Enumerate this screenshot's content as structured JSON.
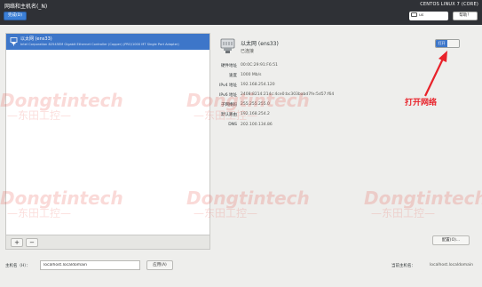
{
  "header": {
    "title": "网络和主机名(_N)",
    "done_label": "完成(D)",
    "os_label": "CENTOS LINUX 7 (CORE)",
    "keyboard_label": "us",
    "help_label": "帮助！"
  },
  "connection_list": {
    "items": [
      {
        "name": "以太网 (ens33)",
        "description": "Intel Corporation 82545EM Gigabit Ethernet Controller (Copper) (PRO/1000 MT Single Port Adapter)",
        "selected": true
      }
    ],
    "add_label": "+",
    "remove_label": "−"
  },
  "details": {
    "name": "以太网 (ens33)",
    "status": "已连接",
    "toggle_label": "打开",
    "toggle_state": "on",
    "info": [
      {
        "label": "硬件地址",
        "value": "00:0C:29:91:F6:51"
      },
      {
        "label": "速度",
        "value": "1000 Mb/s"
      },
      {
        "label": "IPv4 地址",
        "value": "192.168.254.120"
      },
      {
        "label": "IPv6 地址",
        "value": "2408:8214:214c:4ce0:bc303babd7fe:5d57:f64"
      },
      {
        "label": "子网掩码",
        "value": "255.255.255.0"
      },
      {
        "label": "默认路由",
        "value": "192.168.254.2"
      },
      {
        "label": "DNS",
        "value": "202.100.134.86"
      }
    ],
    "configure_label": "配置(O)..."
  },
  "annotation": {
    "text": "打开网络",
    "color": "#e8222a"
  },
  "footer": {
    "hostname_label": "主机名（H）：",
    "hostname_value": "localhost.localdomain",
    "apply_label": "应用(A)",
    "current_hostname_label": "当前主机名：",
    "current_hostname_value": "localhost.localdomain"
  },
  "watermark": {
    "brand": "Dongtintech",
    "brand_cn": "—东田工控—",
    "color": "#e8463c"
  },
  "colors": {
    "topbar": "#2f3136",
    "accent": "#3d76c9",
    "background": "#eeeeec"
  }
}
